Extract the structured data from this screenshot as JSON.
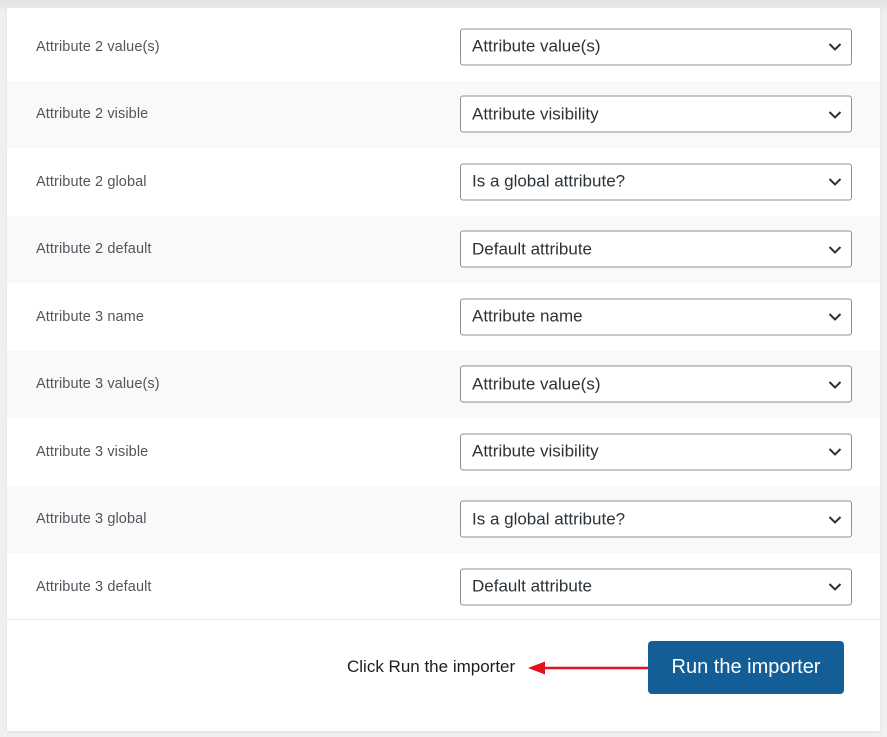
{
  "mapping_rows": [
    {
      "label": "Attribute 2 value(s)",
      "selected": "Attribute value(s)"
    },
    {
      "label": "Attribute 2 visible",
      "selected": "Attribute visibility"
    },
    {
      "label": "Attribute 2 global",
      "selected": "Is a global attribute?"
    },
    {
      "label": "Attribute 2 default",
      "selected": "Default attribute"
    },
    {
      "label": "Attribute 3 name",
      "selected": "Attribute name"
    },
    {
      "label": "Attribute 3 value(s)",
      "selected": "Attribute value(s)"
    },
    {
      "label": "Attribute 3 visible",
      "selected": "Attribute visibility"
    },
    {
      "label": "Attribute 3 global",
      "selected": "Is a global attribute?"
    },
    {
      "label": "Attribute 3 default",
      "selected": "Default attribute"
    }
  ],
  "footer": {
    "annotation": "Click Run the importer",
    "run_button_label": "Run the importer"
  },
  "colors": {
    "button": "#135e96",
    "arrow": "#e3101e",
    "alt_row": "#f9f9f9"
  },
  "icons": {
    "select_arrow": "chevron-down-icon",
    "annotation_arrow": "arrow-left-icon"
  }
}
